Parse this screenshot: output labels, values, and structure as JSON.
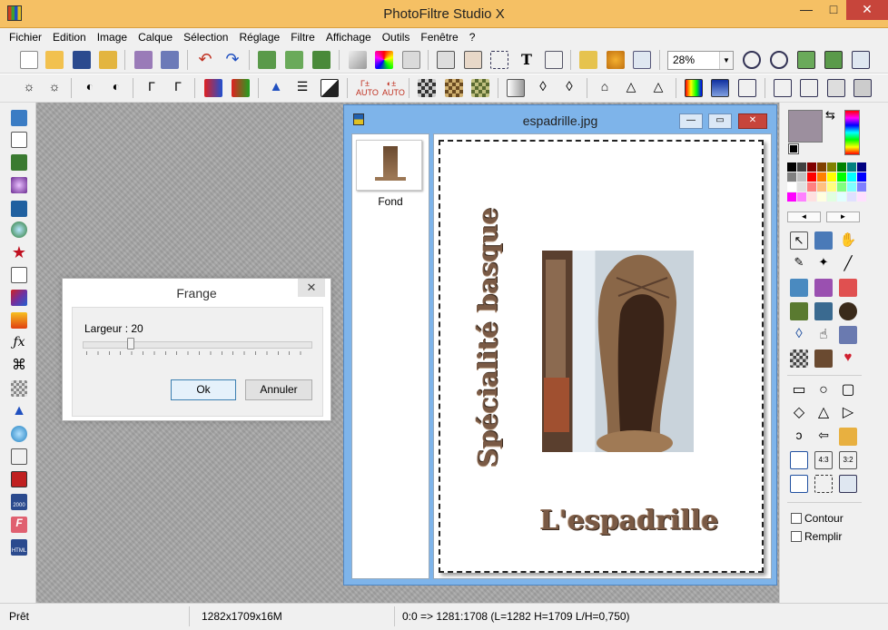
{
  "app": {
    "title": "PhotoFiltre Studio X",
    "minimize": "—",
    "maximize": "□",
    "close": "✕"
  },
  "menu": [
    "Fichier",
    "Edition",
    "Image",
    "Calque",
    "Sélection",
    "Réglage",
    "Filtre",
    "Affichage",
    "Outils",
    "Fenêtre",
    "?"
  ],
  "toolbar": {
    "zoom_value": "28%",
    "text_tool_glyph": "T"
  },
  "dialog": {
    "title": "Frange",
    "close": "✕",
    "width_label": "Largeur : 20",
    "width_value": 20,
    "ok_label": "Ok",
    "cancel_label": "Annuler"
  },
  "document": {
    "title": "espadrille.jpg",
    "minimize": "—",
    "maximize": "▭",
    "close": "✕",
    "layer_name": "Fond",
    "vertical_text": "Spécialité basque",
    "horizontal_text": "L'espadrille"
  },
  "right_panel": {
    "contour_label": "Contour",
    "remplir_label": "Remplir",
    "ratio_43": "4:3",
    "ratio_32": "3:2"
  },
  "status": {
    "state": "Prêt",
    "image_info": "1282x1709x16M",
    "coords": "0:0 => 1281:1708 (L=1282  H=1709  L/H=0,750)"
  },
  "colors": {
    "titlebar": "#f5c064",
    "doc_frame": "#7eb4ea",
    "foreground": "#9c8f9e",
    "background": "#000000"
  }
}
